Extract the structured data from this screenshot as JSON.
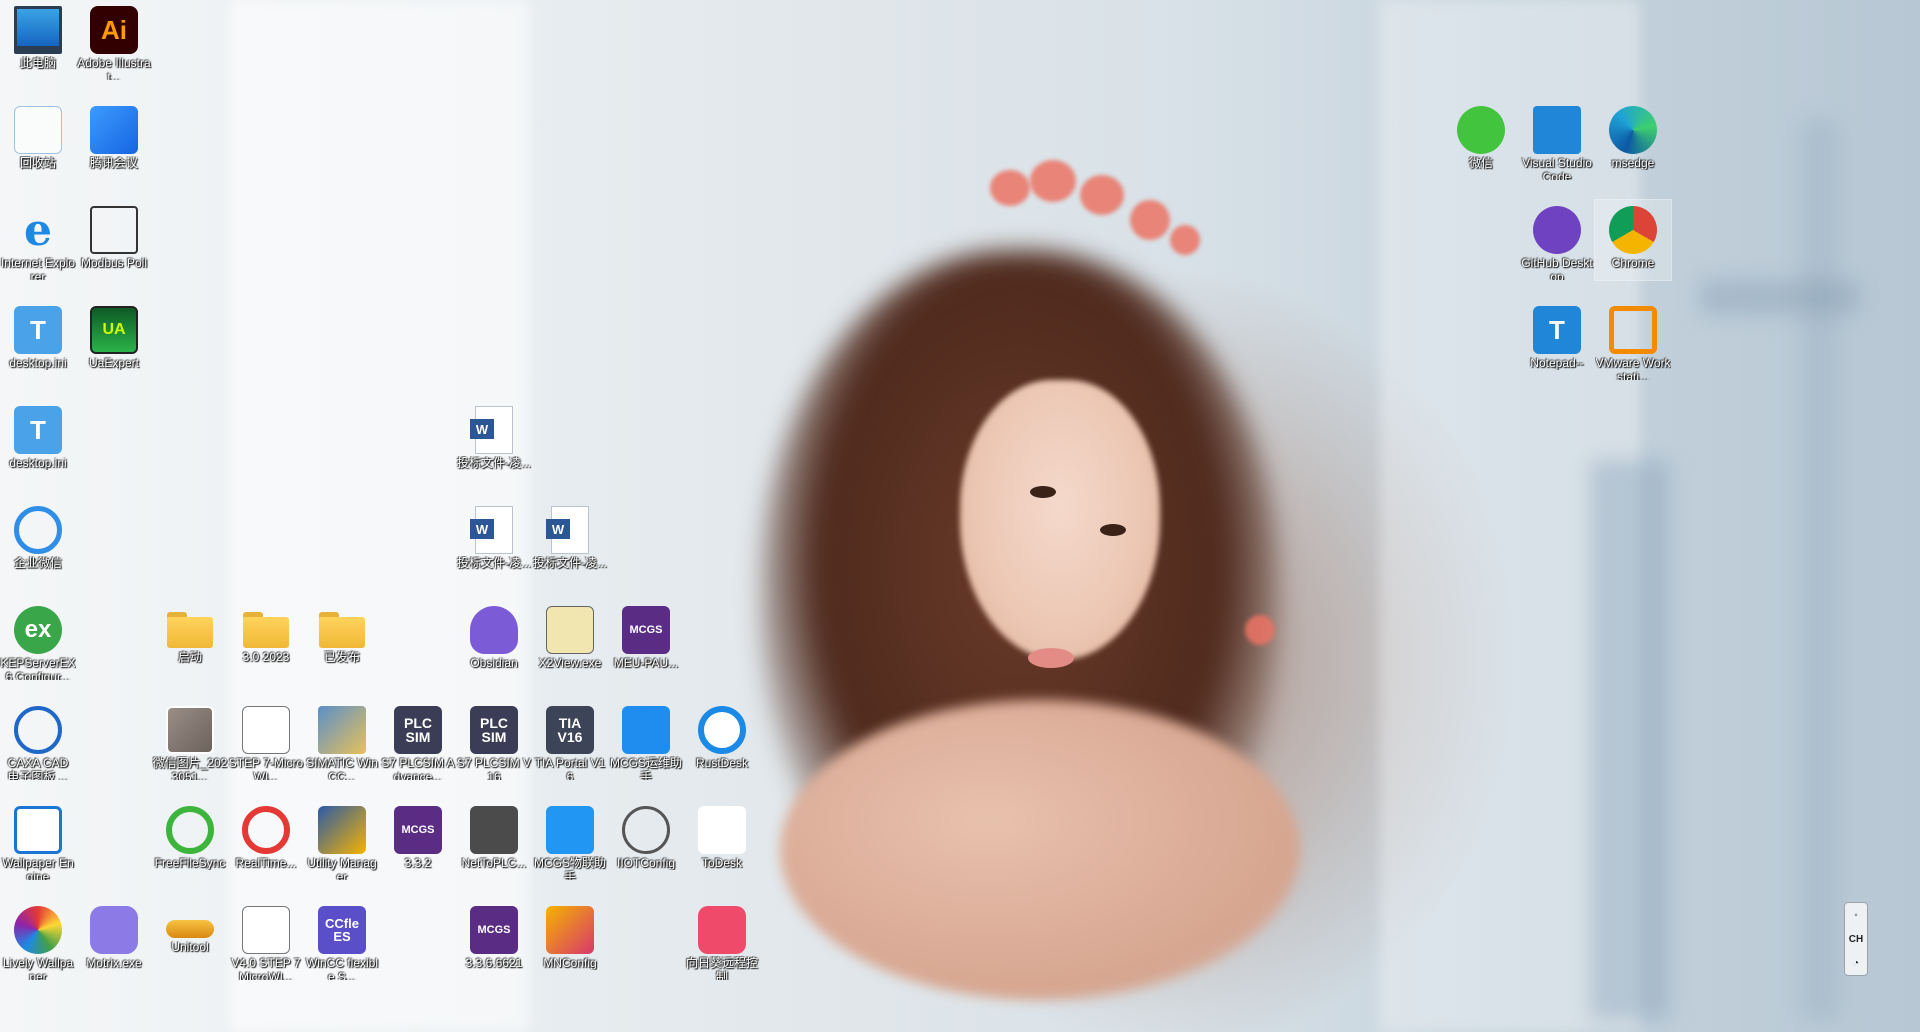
{
  "desktop": {
    "icons": [
      {
        "label": "此电脑",
        "icon": "this-pc-icon"
      },
      {
        "label": "Adobe Illustrat...",
        "icon": "adobe-illustrator-icon",
        "glyph": "Ai"
      },
      {
        "label": "回收站",
        "icon": "recycle-bin-icon"
      },
      {
        "label": "腾讯会议",
        "icon": "tencent-meeting-icon"
      },
      {
        "label": "Internet Explorer",
        "icon": "internet-explorer-icon",
        "glyph": "e"
      },
      {
        "label": "Modbus Poll",
        "icon": "modbus-poll-icon"
      },
      {
        "label": "desktop.ini",
        "icon": "text-file-icon",
        "glyph": "T"
      },
      {
        "label": "UaExpert",
        "icon": "uaexpert-icon",
        "glyph": "UA"
      },
      {
        "label": "desktop.ini",
        "icon": "text-file-icon",
        "glyph": "T"
      },
      {
        "label": "企业微信",
        "icon": "wecom-icon"
      },
      {
        "label": "KEPServerEX 6 Configur...",
        "icon": "kepserver-icon",
        "glyph": "ex"
      },
      {
        "label": "CAXA CAD 电子图板 ...",
        "icon": "caxa-cad-icon"
      },
      {
        "label": "Wallpaper Engine",
        "icon": "wallpaper-engine-icon"
      },
      {
        "label": "Lively Wallpaper",
        "icon": "lively-wallpaper-icon"
      },
      {
        "label": "Motrix.exe",
        "icon": "motrix-icon"
      },
      {
        "label": "启动",
        "icon": "folder-icon"
      },
      {
        "label": "3.0 2023",
        "icon": "folder-icon"
      },
      {
        "label": "已发布",
        "icon": "folder-icon"
      },
      {
        "label": "微信图片_2023051...",
        "icon": "image-file-icon"
      },
      {
        "label": "STEP 7-MicroWI...",
        "icon": "step7-microwin-icon"
      },
      {
        "label": "SIMATIC WinCC...",
        "icon": "simatic-wincc-icon"
      },
      {
        "label": "S7 PLCSIM Advance...",
        "icon": "plcsim-advanced-icon",
        "glyph": "PLC SIM"
      },
      {
        "label": "S7 PLCSIM V16",
        "icon": "plcsim-icon",
        "glyph": "PLC SIM"
      },
      {
        "label": "TIA Portal V16",
        "icon": "tia-portal-icon",
        "glyph": "TIA V16"
      },
      {
        "label": "MCGS运维助手",
        "icon": "mcgs-ops-icon"
      },
      {
        "label": "RustDesk",
        "icon": "rustdesk-icon"
      },
      {
        "label": "FreeFileSync",
        "icon": "freefilesync-icon"
      },
      {
        "label": "RealTime...",
        "icon": "realtimesync-icon"
      },
      {
        "label": "Utility Manager",
        "icon": "utility-manager-icon"
      },
      {
        "label": "3.3.2",
        "icon": "mcgs-icon",
        "glyph": "MCGS"
      },
      {
        "label": "NetToPLC...",
        "icon": "nettoplc-icon"
      },
      {
        "label": "MCGS物联助手",
        "icon": "mcgs-iot-icon"
      },
      {
        "label": "IIOTConfig",
        "icon": "iiotconfig-icon"
      },
      {
        "label": "ToDesk",
        "icon": "todesk-icon"
      },
      {
        "label": "Unitool",
        "icon": "unitool-icon"
      },
      {
        "label": "V4.0 STEP 7 MicroWI...",
        "icon": "step7-v4-icon"
      },
      {
        "label": "WinCC flexible S...",
        "icon": "wincc-flexible-icon",
        "glyph": "CCfle ES"
      },
      {
        "label": "3.3.6.6621",
        "icon": "mcgs-icon",
        "glyph": "MCGS"
      },
      {
        "label": "MNConfig",
        "icon": "mnconfig-icon"
      },
      {
        "label": "向日葵远程控制",
        "icon": "sunlogin-icon"
      },
      {
        "label": "投标文件-凌...",
        "icon": "word-doc-icon",
        "glyph": "W"
      },
      {
        "label": "投标文件-凌...",
        "icon": "word-doc-icon",
        "glyph": "W"
      },
      {
        "label": "投标文件-凌...",
        "icon": "word-doc-icon",
        "glyph": "W"
      },
      {
        "label": "Obsidian",
        "icon": "obsidian-icon"
      },
      {
        "label": "X2View.exe",
        "icon": "x2view-icon"
      },
      {
        "label": "MEU-PAU...",
        "icon": "mcgs-icon",
        "glyph": "MCGS"
      },
      {
        "label": "微信",
        "icon": "wechat-icon"
      },
      {
        "label": "Visual Studio Code",
        "icon": "vscode-icon"
      },
      {
        "label": "msedge",
        "icon": "edge-icon"
      },
      {
        "label": "GitHub Desktop",
        "icon": "github-desktop-icon"
      },
      {
        "label": "Chrome",
        "icon": "chrome-icon"
      },
      {
        "label": "Notepad--",
        "icon": "notepad-icon",
        "glyph": "T"
      },
      {
        "label": "VMware Workstati...",
        "icon": "vmware-icon"
      }
    ]
  },
  "ime": {
    "label": "CH"
  }
}
